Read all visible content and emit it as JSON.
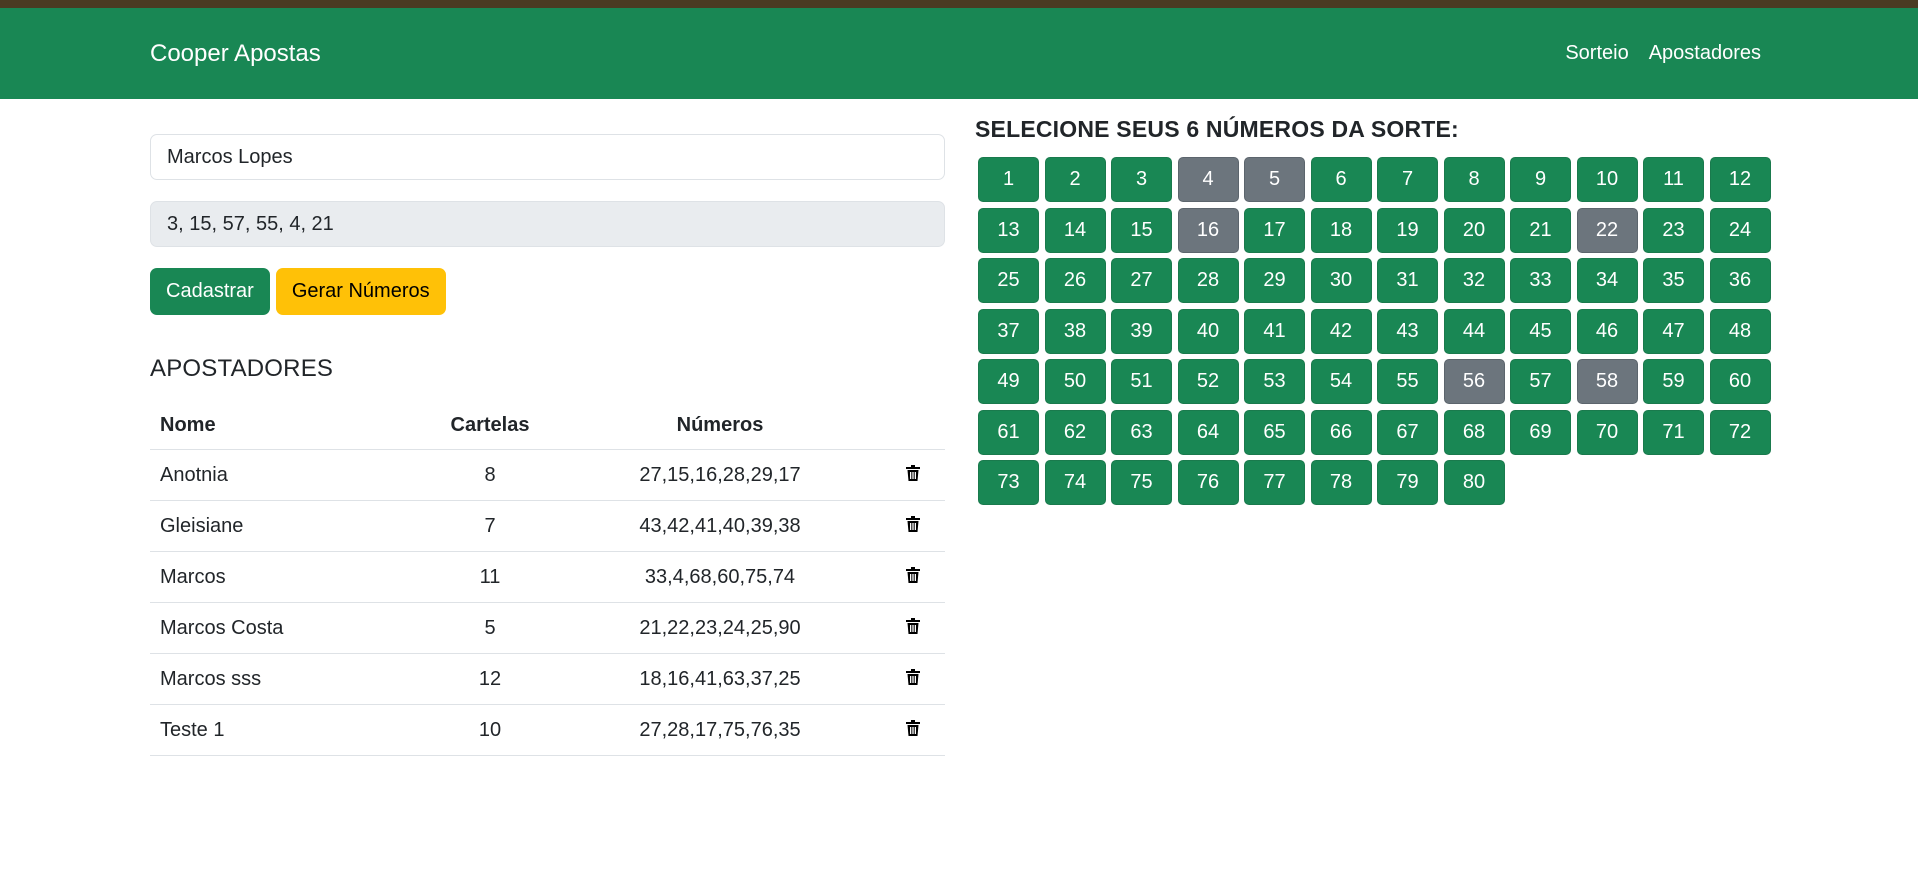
{
  "navbar": {
    "brand": "Cooper Apostas",
    "links": [
      "Sorteio",
      "Apostadores"
    ]
  },
  "form": {
    "name_value": "Marcos Lopes",
    "numbers_value": "3, 15, 57, 55, 4, 21",
    "register_label": "Cadastrar",
    "generate_label": "Gerar Números"
  },
  "players": {
    "title": "APOSTADORES",
    "headers": [
      "Nome",
      "Cartelas",
      "Números"
    ],
    "rows": [
      {
        "name": "Anotnia",
        "cards": "8",
        "numbers": "27,15,16,28,29,17"
      },
      {
        "name": "Gleisiane",
        "cards": "7",
        "numbers": "43,42,41,40,39,38"
      },
      {
        "name": "Marcos",
        "cards": "11",
        "numbers": "33,4,68,60,75,74"
      },
      {
        "name": "Marcos Costa",
        "cards": "5",
        "numbers": "21,22,23,24,25,90"
      },
      {
        "name": "Marcos sss",
        "cards": "12",
        "numbers": "18,16,41,63,37,25"
      },
      {
        "name": "Teste 1",
        "cards": "10",
        "numbers": "27,28,17,75,76,35"
      }
    ],
    "delete_icon": "trash-icon"
  },
  "picker": {
    "title": "SELECIONE SEUS 6 NÚMEROS DA SORTE:",
    "total": 80,
    "selected": [
      4,
      5,
      16,
      22,
      56,
      58
    ]
  },
  "colors": {
    "primary": "#198754",
    "warning": "#ffc107",
    "selected": "#6c757d",
    "topstrip": "#4a3b22"
  }
}
